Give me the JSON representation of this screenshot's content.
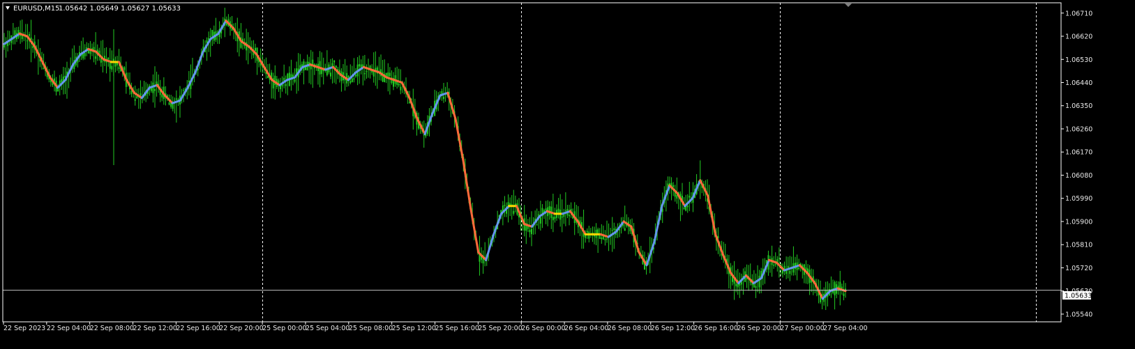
{
  "header": {
    "symbol": "EURUSD,M15",
    "ohlc": "1.05642 1.05649 1.05627 1.05633"
  },
  "current_price": "1.05633",
  "colors": {
    "background": "#000000",
    "candles": "#22cc22",
    "ma_up": "#6495ed",
    "ma_down": "#ff6a3a",
    "ma_neutral": "#ffd700",
    "grid_separator": "#ffffff",
    "axis": "#ffffff",
    "price_line": "#c0c0c0"
  },
  "chart_data": {
    "type": "line",
    "title": "EURUSD,M15",
    "xlabel": "",
    "ylabel": "",
    "ylim": [
      1.0551,
      1.0675
    ],
    "y_ticks": [
      "1.06710",
      "1.06620",
      "1.06530",
      "1.06440",
      "1.06350",
      "1.06260",
      "1.06170",
      "1.06080",
      "1.05990",
      "1.05900",
      "1.05810",
      "1.05720",
      "1.05630",
      "1.05540"
    ],
    "x_ticks": [
      "22 Sep 2023",
      "22 Sep 04:00",
      "22 Sep 08:00",
      "22 Sep 12:00",
      "22 Sep 16:00",
      "22 Sep 20:00",
      "25 Sep 00:00",
      "25 Sep 04:00",
      "25 Sep 08:00",
      "25 Sep 12:00",
      "25 Sep 16:00",
      "25 Sep 20:00",
      "26 Sep 00:00",
      "26 Sep 04:00",
      "26 Sep 08:00",
      "26 Sep 12:00",
      "26 Sep 16:00",
      "26 Sep 20:00",
      "27 Sep 00:00",
      "27 Sep 04:00"
    ],
    "day_separators": [
      "25 Sep 00:00",
      "26 Sep 00:00",
      "27 Sep 00:00"
    ],
    "grid": false,
    "series": [
      {
        "values": [
          1.0659,
          1.0661,
          1.0663,
          1.0662,
          1.0658,
          1.0652,
          1.0646,
          1.0642,
          1.0645,
          1.0651,
          1.0655,
          1.0657,
          1.0656,
          1.0653,
          1.0652,
          1.0652,
          1.0645,
          1.064,
          1.0638,
          1.0642,
          1.0643,
          1.0639,
          1.0636,
          1.0637,
          1.0642,
          1.0648,
          1.0656,
          1.0661,
          1.0663,
          1.0668,
          1.0665,
          1.066,
          1.0658,
          1.0655,
          1.065,
          1.0645,
          1.0643,
          1.0645,
          1.0646,
          1.065,
          1.0651,
          1.065,
          1.0649,
          1.065,
          1.0647,
          1.0645,
          1.0648,
          1.065,
          1.0649,
          1.0648,
          1.0646,
          1.0645,
          1.0644,
          1.0638,
          1.063,
          1.0624,
          1.0632,
          1.0639,
          1.064,
          1.063,
          1.0614,
          1.0595,
          1.0578,
          1.0575,
          1.0585,
          1.0593,
          1.0596,
          1.0596,
          1.0589,
          1.0588,
          1.0592,
          1.0594,
          1.0593,
          1.0593,
          1.0594,
          1.059,
          1.0585,
          1.0585,
          1.0585,
          1.0584,
          1.0586,
          1.059,
          1.0588,
          1.0578,
          1.0573,
          1.0582,
          1.0596,
          1.0604,
          1.0601,
          1.0596,
          1.0599,
          1.0606,
          1.06,
          1.0585,
          1.0577,
          1.057,
          1.0566,
          1.0569,
          1.0566,
          1.0568,
          1.0575,
          1.0574,
          1.0571,
          1.0572,
          1.0573,
          1.057,
          1.0566,
          1.056,
          1.0563,
          1.0564,
          1.0563
        ]
      }
    ]
  }
}
